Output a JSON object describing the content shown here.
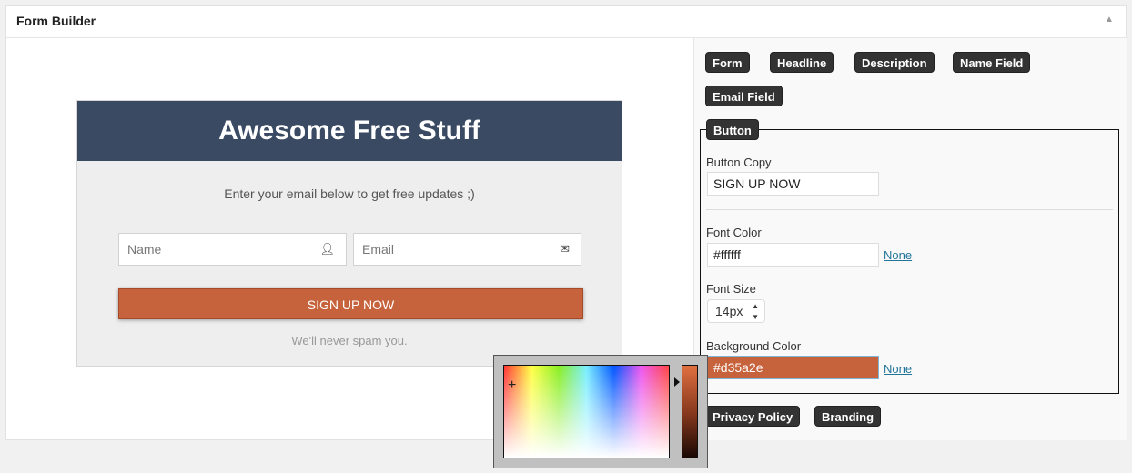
{
  "header": {
    "title": "Form Builder",
    "collapse_icon": "▲"
  },
  "preview": {
    "headline": "Awesome Free Stuff",
    "description": "Enter your email below to get free updates ;)",
    "name_placeholder": "Name",
    "email_placeholder": "Email",
    "button": "SIGN UP NOW",
    "footer": "We'll never spam you.",
    "colors": {
      "header": "#3a4a63",
      "button": "#c7633c"
    }
  },
  "sections": {
    "form": "Form",
    "headline": "Headline",
    "description": "Description",
    "name_field": "Name Field",
    "email_field": "Email Field",
    "button": "Button",
    "privacy": "Privacy Policy",
    "branding": "Branding"
  },
  "button_settings": {
    "copy_label": "Button Copy",
    "copy_value": "SIGN UP NOW",
    "font_color_label": "Font Color",
    "font_color_value": "#ffffff",
    "none": "None",
    "font_size_label": "Font Size",
    "font_size_value": "14px",
    "bg_color_label": "Background Color",
    "bg_color_value": "#d35a2e"
  }
}
